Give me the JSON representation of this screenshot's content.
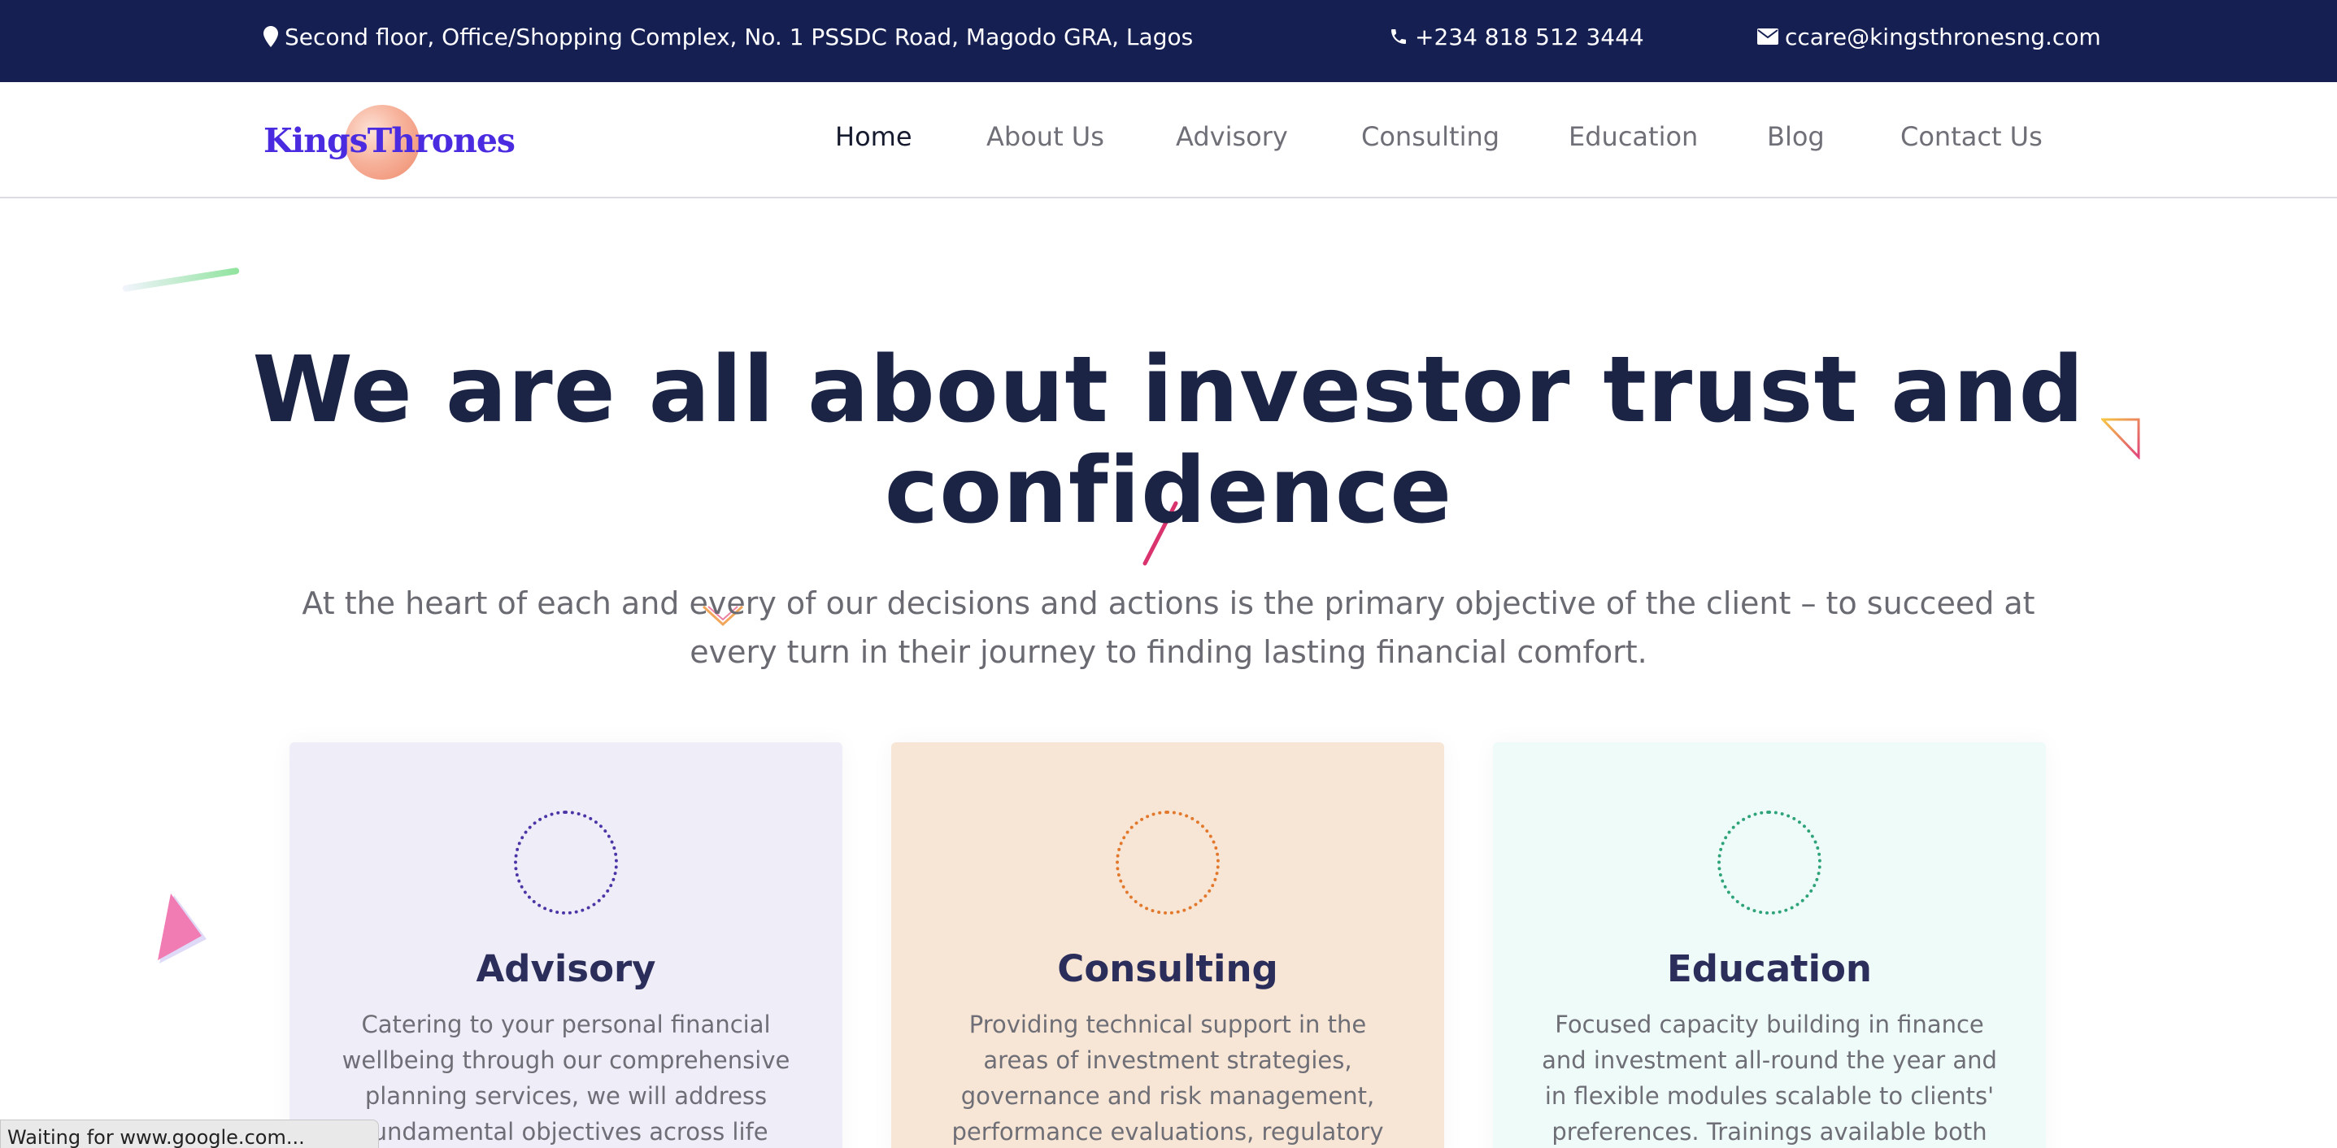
{
  "topbar": {
    "address": "Second floor, Office/Shopping Complex, No. 1 PSSDC Road, Magodo GRA, Lagos",
    "phone": "+234 818 512 3444",
    "email": "ccare@kingsthronesng.com",
    "icons": [
      "map-marker-icon",
      "phone-icon",
      "envelope-icon"
    ]
  },
  "header": {
    "logo_text": "KingsThrones",
    "nav": [
      {
        "label": "Home",
        "active": true
      },
      {
        "label": "About Us",
        "active": false
      },
      {
        "label": "Advisory",
        "active": false
      },
      {
        "label": "Consulting",
        "active": false
      },
      {
        "label": "Education",
        "active": false
      },
      {
        "label": "Blog",
        "active": false
      },
      {
        "label": "Contact Us",
        "active": false
      }
    ]
  },
  "hero": {
    "title_line1": "We are all about investor trust and",
    "title_line2": "confidence",
    "subtitle_line1": "At the heart of each and every of our decisions and actions is the primary objective of the client – to succeed at",
    "subtitle_line2": "every turn in their journey to finding lasting financial comfort."
  },
  "services": [
    {
      "title": "Advisory",
      "text": "Catering to your personal financial wellbeing through our comprehensive planning services, we will address fundamental objectives across life",
      "color": "#4b35a6"
    },
    {
      "title": "Consulting",
      "text": "Providing technical support in the areas of investment strategies, governance and risk management, performance evaluations, regulatory compliance,",
      "color": "#e2782c"
    },
    {
      "title": "Education",
      "text": "Focused capacity building in finance and investment all-round the year and in flexible modules scalable to clients' preferences. Trainings available both on",
      "color": "#2ea37a"
    }
  ],
  "browser": {
    "status_text": "Waiting for www.google.com..."
  },
  "colors": {
    "topbar_bg": "#151f52",
    "logo": "#4a2be0",
    "heading": "#1b2444"
  }
}
